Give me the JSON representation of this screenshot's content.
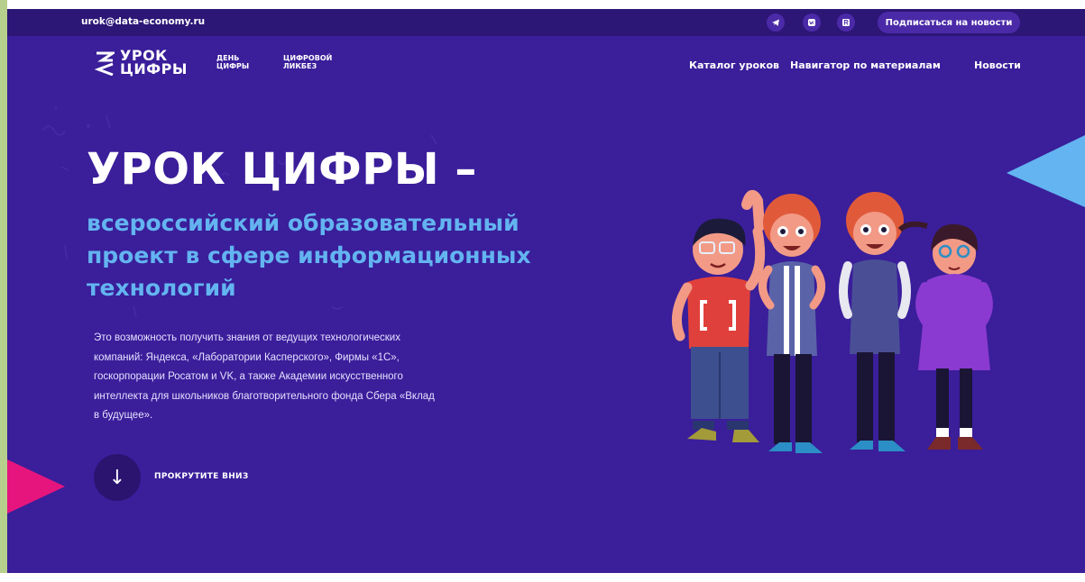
{
  "topbar": {
    "email": "urok@data-economy.ru",
    "social": [
      {
        "icon": "telegram-icon",
        "glyph": "◄"
      },
      {
        "icon": "vk-icon",
        "glyph": "vk"
      },
      {
        "icon": "r-icon",
        "glyph": "R"
      }
    ],
    "subscribe_label": "Подписаться на новости"
  },
  "header": {
    "logo_line1": "УРОК",
    "logo_line2": "ЦИФРЫ",
    "day_line1": "ДЕНЬ",
    "day_line2": "ЦИФРЫ",
    "likbez_line1": "ЦИФРОВОЙ",
    "likbez_line2": "ЛИКБЕЗ",
    "nav": [
      "Каталог уроков",
      "Навигатор по материалам",
      "Новости"
    ]
  },
  "hero": {
    "title": "УРОК ЦИФРЫ –",
    "subtitle_lines": [
      "всероссийский образовательный",
      "проект в сфере информационных",
      "технологий"
    ],
    "description_lines": [
      "Это возможность получить знания от ведущих технологических",
      "компаний: Яндекса, «Лаборатории Касперского», Фирмы «1С»,",
      "госкорпорации Росатом и VK, а также Академии искусственного",
      "интеллекта для школьников благотворительного фонда Сбера «Вклад",
      "в будущее»."
    ],
    "scroll_arrow": "↓",
    "scroll_label": "ПРОКРУТИТЕ ВНИЗ"
  },
  "colors": {
    "background": "#3a1e9a",
    "topbar": "#2c1676",
    "accent_blue": "#63b4f0",
    "accent_pink": "#e6157e"
  }
}
